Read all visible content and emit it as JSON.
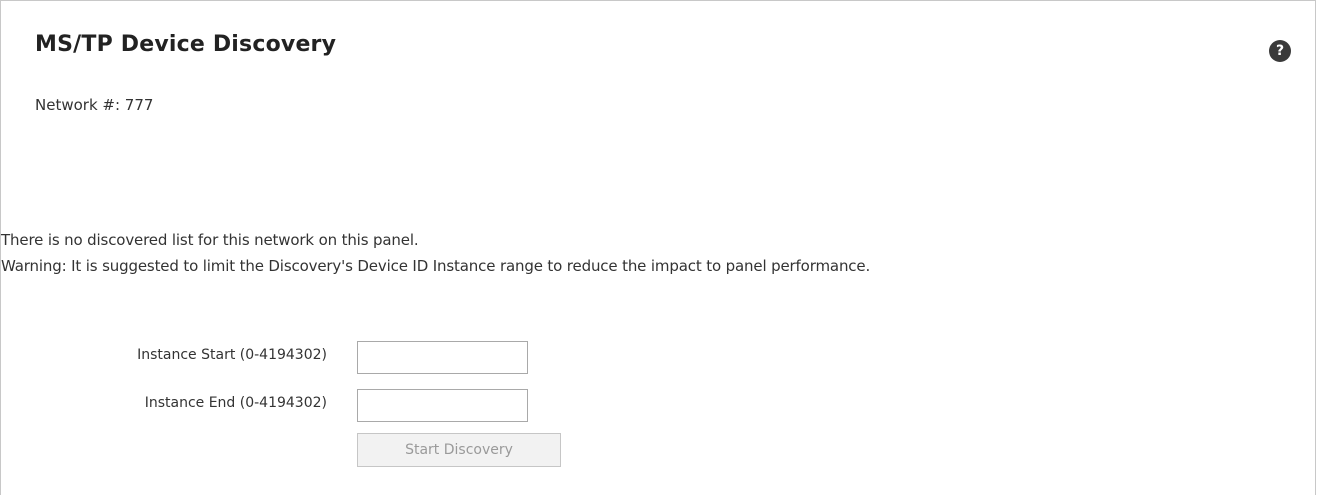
{
  "panel": {
    "title": "MS/TP Device Discovery",
    "help_glyph": "?",
    "help_icon": "help-question-icon",
    "network_text": "Network #: 777"
  },
  "messages": {
    "no_list": "There is no discovered list for this network on this panel.",
    "warning": "Warning: It is suggested to limit the Discovery's Device ID Instance range to reduce the impact to panel performance."
  },
  "form": {
    "instance_start_label": "Instance Start (0-4194302)",
    "instance_start_value": "",
    "instance_end_label": "Instance End (0-4194302)",
    "instance_end_value": "",
    "start_button_label": "Start Discovery"
  },
  "colors": {
    "help_bg": "#3a3a3a",
    "button_text_disabled": "#9a9a9a",
    "border": "#c8c8c8"
  }
}
